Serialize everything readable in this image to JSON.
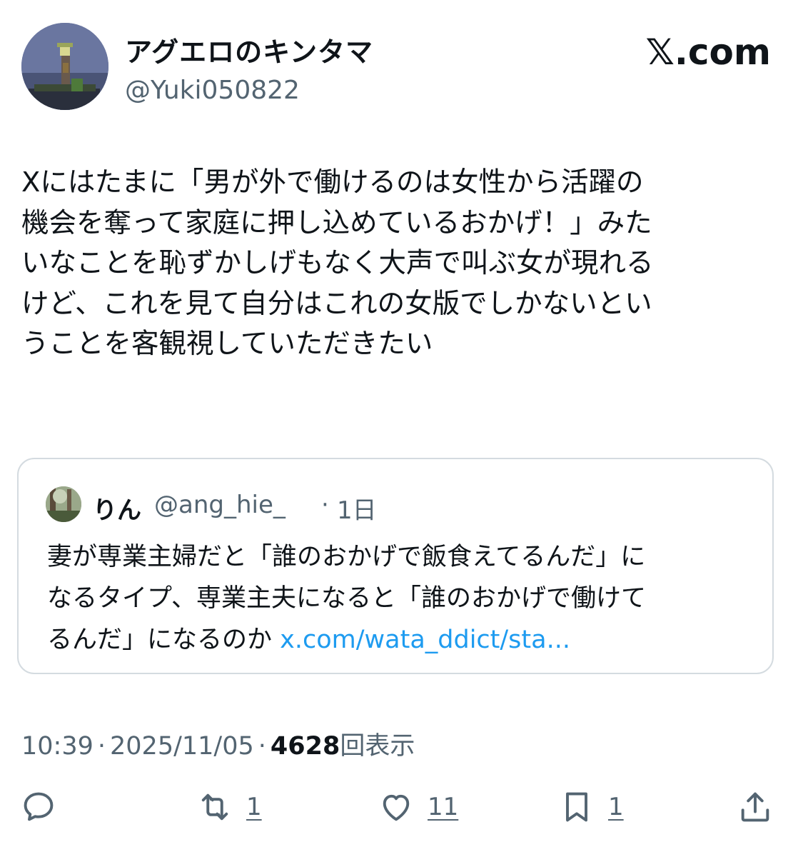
{
  "author": {
    "display_name": "アグエロのキンタマ",
    "handle": "@Yuki050822"
  },
  "brand": "𝕏.com",
  "tweet": {
    "lines": [
      "Xにはたまに「男が外で働けるのは女性から活躍の",
      "機会を奪って家庭に押し込めているおかげ！」みた",
      "いなことを恥ずかしげもなく大声で叫ぶ女が現れる",
      "けど、これを見て自分はこれの女版でしかないとい",
      "うことを客観視していただきたい"
    ]
  },
  "quote": {
    "name": "りん",
    "handle": "@ang_hie_",
    "dot": "·",
    "time": "1日",
    "lines": [
      "妻が専業主婦だと「誰のおかげで飯食えてるんだ」に",
      "なるタイプ、専業主夫になると「誰のおかげで働けて"
    ],
    "last_line_text": "るんだ」になるのか ",
    "link": "x.com/wata_ddict/sta..."
  },
  "meta": {
    "time": "10:39",
    "separator": "·",
    "date": "2025/11/05",
    "views_count": "4628",
    "views_label": "回表示"
  },
  "actions": {
    "reply": {
      "icon": "reply-icon",
      "count": ""
    },
    "repost": {
      "icon": "repost-icon",
      "count": "1"
    },
    "like": {
      "icon": "heart-icon",
      "count": "11"
    },
    "bookmark": {
      "icon": "bookmark-icon",
      "count": "1"
    },
    "share": {
      "icon": "share-icon",
      "count": ""
    }
  },
  "colors": {
    "text": "#0f1419",
    "secondary": "#536471",
    "link": "#1d9bf0",
    "border": "#d4dbe0"
  }
}
